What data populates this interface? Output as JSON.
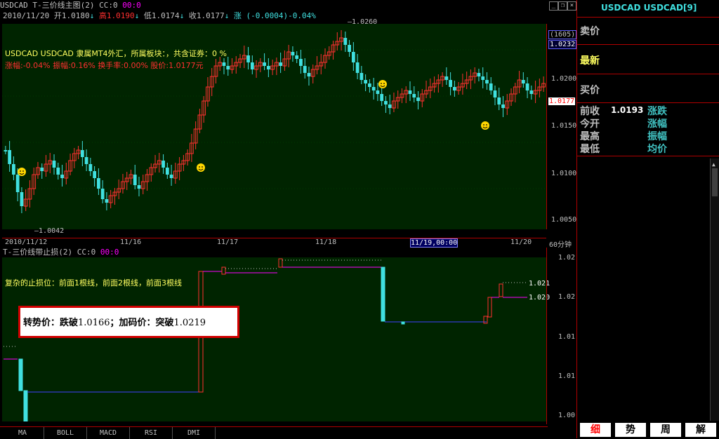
{
  "header": {
    "symbol_title": "USDCAD T-三价线主图(2)",
    "cc_label": "CC:0",
    "cc_value": "00:0",
    "date": "2010/11/20",
    "open_label": "开",
    "open_value": "1.0180",
    "high_label": "高",
    "high_value": "1.0190",
    "low_label": "低",
    "low_value": "1.0174",
    "close_label": "收",
    "close_value": "1.0177",
    "change_label": "涨",
    "change_value": "(-0.0004)",
    "change_pct": "-0.04%"
  },
  "info_overlay": {
    "line1": "USDCAD USDCAD 隶属MT4外汇，所属板块：，共含证券：0 %",
    "line2": "涨幅:-0.04% 振幅:0.16% 换手率:0.00% 股价:1.0177元"
  },
  "price_axis": {
    "count_label": "(1605)",
    "top_value": "1.0232",
    "current_value": "1.0177",
    "ticks": [
      "1.0200",
      "1.0150",
      "1.0100",
      "1.0050"
    ],
    "high_marker": "1.0260",
    "low_marker": "1.0042"
  },
  "date_axis": {
    "dates": [
      "2010/11/12",
      "11/16",
      "11/17",
      "11/18",
      "11/19,00:00",
      "11/20"
    ],
    "period": "60分钟"
  },
  "sub_chart": {
    "title": "T-三价线带止损(2)",
    "cc_label": "CC:0",
    "cc_value": "00:0",
    "annotation": "复杂的止损位：前面1根线，前面2根线，前面3根线",
    "axis_ticks": [
      "1.02",
      "1.02",
      "1.01",
      "1.01",
      "1.00"
    ],
    "right_labels": [
      "1.021",
      "1.020"
    ]
  },
  "popup": {
    "text_prefix": "转势价：跌破",
    "break_down": "1.0166",
    "text_mid": "；加码价：突破",
    "break_up": "1.0219"
  },
  "bottom_tabs": [
    "MA",
    "BOLL",
    "MACD",
    "RSI",
    "DMI"
  ],
  "right_panel": {
    "title": "USDCAD USDCAD[9]",
    "sell_label": "卖价",
    "latest_label": "最新",
    "buy_label": "买价",
    "prev_close_label": "前收",
    "prev_close_value": "1.0193",
    "change_label": "涨跌",
    "open_label": "今开",
    "change_pct_label": "涨幅",
    "high_label": "最高",
    "amplitude_label": "振幅",
    "low_label": "最低",
    "avg_label": "均价",
    "bottom_tabs": [
      "细",
      "势",
      "周",
      "解"
    ]
  },
  "colors": {
    "up": "#ff3030",
    "down": "#40e0e0",
    "grid_bg": "#002400",
    "frame": "#b00000",
    "panel_text": "#40c0c0",
    "smiley": "#ffd700"
  }
}
